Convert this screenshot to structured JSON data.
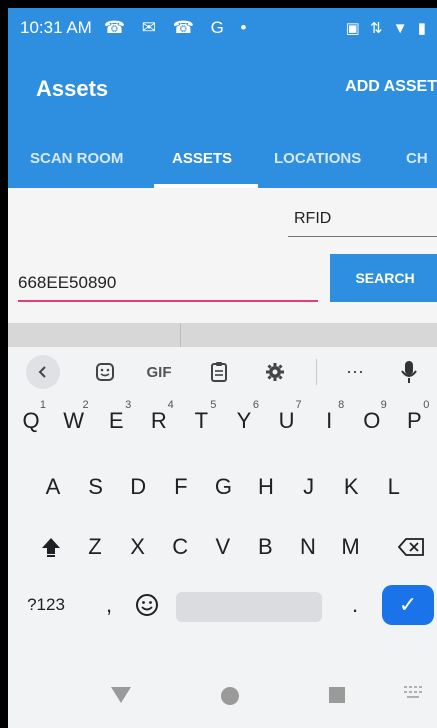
{
  "status_bar": {
    "time": "10:31 AM",
    "left_icons": "☎ ✉ ☎ G •",
    "right_icons": "▣ ⇅ ▼ ▮"
  },
  "app_bar": {
    "title": "Assets",
    "action": "ADD ASSET"
  },
  "tabs": [
    {
      "label": "SCAN ROOM"
    },
    {
      "label": "ASSETS"
    },
    {
      "label": "LOCATIONS"
    },
    {
      "label": "CH"
    }
  ],
  "active_tab": "ASSETS",
  "form": {
    "select_value": "RFID",
    "search_value": "668EE50890",
    "search_button": "SEARCH"
  },
  "keyboard": {
    "toolbar": {
      "gif": "GIF",
      "more": "⋯"
    },
    "row1": [
      {
        "k": "Q",
        "n": "1"
      },
      {
        "k": "W",
        "n": "2"
      },
      {
        "k": "E",
        "n": "3"
      },
      {
        "k": "R",
        "n": "4"
      },
      {
        "k": "T",
        "n": "5"
      },
      {
        "k": "Y",
        "n": "6"
      },
      {
        "k": "U",
        "n": "7"
      },
      {
        "k": "I",
        "n": "8"
      },
      {
        "k": "O",
        "n": "9"
      },
      {
        "k": "P",
        "n": "0"
      }
    ],
    "row2": [
      "A",
      "S",
      "D",
      "F",
      "G",
      "H",
      "J",
      "K",
      "L"
    ],
    "row3": [
      "Z",
      "X",
      "C",
      "V",
      "B",
      "N",
      "M"
    ],
    "symbols": "?123",
    "comma": ",",
    "period": ".",
    "enter": "✓"
  },
  "colors": {
    "primary": "#2e8fe0",
    "input_underline": "#e0407a",
    "enter_key": "#1a73e8"
  }
}
